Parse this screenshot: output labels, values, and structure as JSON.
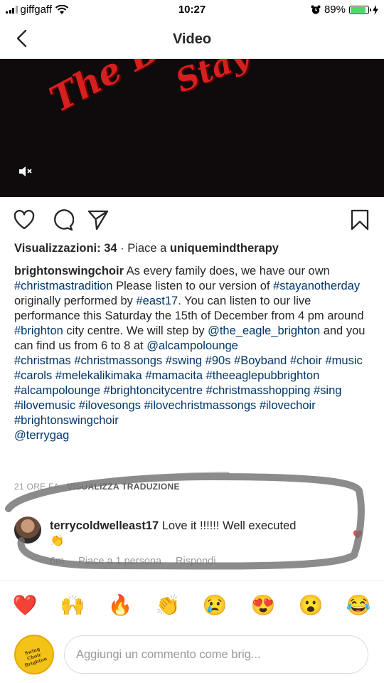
{
  "status_bar": {
    "carrier": "giffgaff",
    "time": "10:27",
    "battery": "89%"
  },
  "nav": {
    "title": "Video"
  },
  "video": {
    "overlay_line1": "The Bright",
    "overlay_line2": "Stay"
  },
  "post": {
    "views_label": "Visualizzazioni: 34",
    "liked_by_prefix": " · Piace a ",
    "liked_by_user": "uniquemindtherapy",
    "caption_author": "brightonswingchoir",
    "caption_parts": [
      {
        "text": " As every family does, we have our own ",
        "tag": false
      },
      {
        "text": "#christmastradition",
        "tag": true
      },
      {
        "text": " Please listen to our version of ",
        "tag": false
      },
      {
        "text": "#stayanotherday",
        "tag": true
      },
      {
        "text": " originally performed by ",
        "tag": false
      },
      {
        "text": "#east17",
        "tag": true
      },
      {
        "text": ". You can listen to our live performance this Saturday the 15th of December from 4 pm around ",
        "tag": false
      },
      {
        "text": "#brighton",
        "tag": true
      },
      {
        "text": " city centre. We will step by ",
        "tag": false
      },
      {
        "text": "@the_eagle_brighton",
        "tag": true
      },
      {
        "text": " and you can find us from 6 to 8 at ",
        "tag": false
      },
      {
        "text": "@alcampolounge",
        "tag": true
      }
    ],
    "hashtags": "#christmas #christmassongs #swing #90s #Boyband #choir #music #carols #melekalikimaka #mamacita #theeaglepubbrighton #alcampolounge #brightoncitycentre #christmasshopping #sing #ilovemusic #ilovesongs #ilovechristmassongs #ilovechoir #brightonswingchoir",
    "mention": "@terrygag",
    "time_ago": "21 ORE FA",
    "translate_label": "VISUALIZZA TRADUZIONE"
  },
  "comment": {
    "author": "terrycoldwelleast17",
    "text": " Love it !!!!!! Well executed",
    "emoji": "👏",
    "time": "6m",
    "likes": "Piace a 1 persona",
    "reply": "Rispondi"
  },
  "emoji_bar": [
    "❤️",
    "🙌",
    "🔥",
    "👏",
    "😢",
    "😍",
    "😮",
    "😂"
  ],
  "composer": {
    "placeholder": "Aggiungi un commento come brig...",
    "avatar_text": "Swing Choir Brighton"
  },
  "colors": {
    "accent_red": "#ed4956",
    "link_blue": "#003569",
    "battery_green": "#4cd964"
  }
}
